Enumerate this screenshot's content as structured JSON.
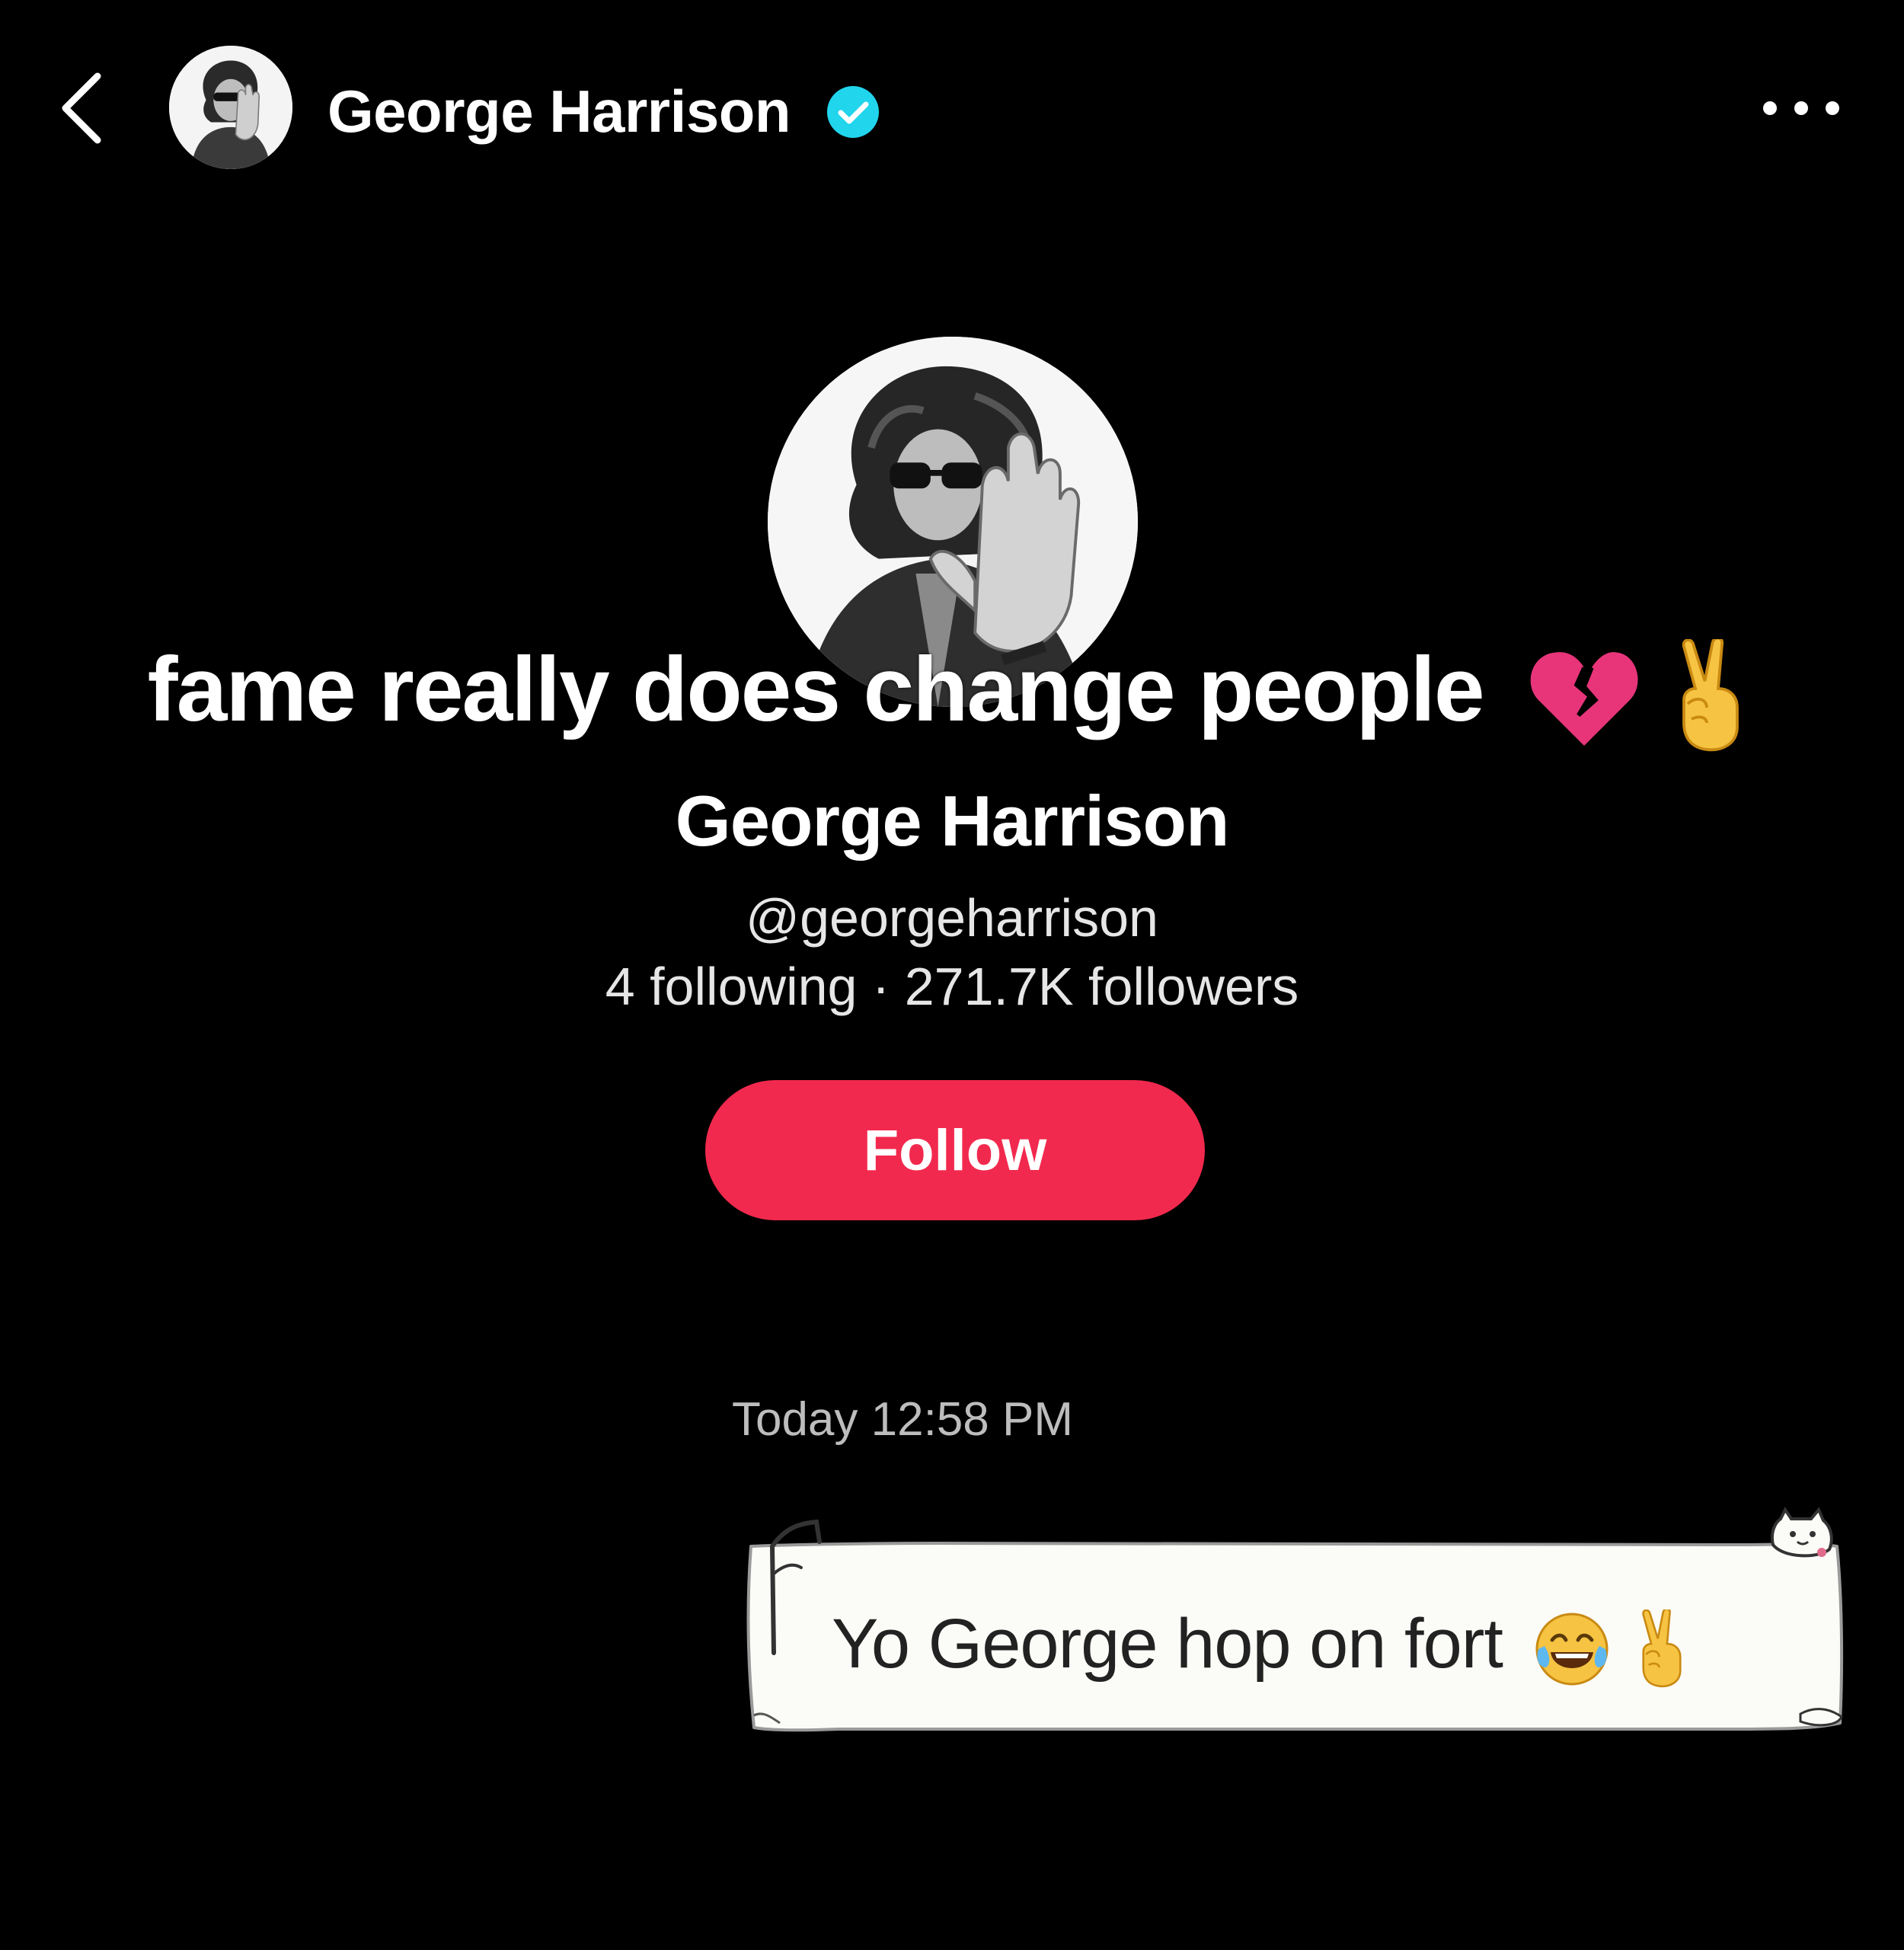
{
  "theme": {
    "background": "#000000",
    "follow_button_color": "#f2294e",
    "verified_color": "#20d5ec",
    "bubble_color": "#fbfbf7"
  },
  "header": {
    "name": "George Harrison",
    "icons": [
      "back-chevron-icon",
      "verified-badge-icon",
      "more-dots-icon"
    ]
  },
  "overlay": {
    "caption": "fame really does change people",
    "caption_emojis": [
      "broken-heart-emoji",
      "victory-hand-emoji"
    ]
  },
  "profile": {
    "name": "George Harrison",
    "handle": "@georgeharrison",
    "following_count": "4",
    "following_label": "following",
    "separator": "·",
    "followers_count": "271.7K",
    "followers_label": "followers",
    "follow_label": "Follow"
  },
  "chat": {
    "timestamp": "Today 12:58 PM",
    "messages": [
      {
        "text": "Yo George hop on fort",
        "emojis": [
          "tears-of-joy-emoji",
          "victory-hand-emoji"
        ]
      }
    ]
  }
}
